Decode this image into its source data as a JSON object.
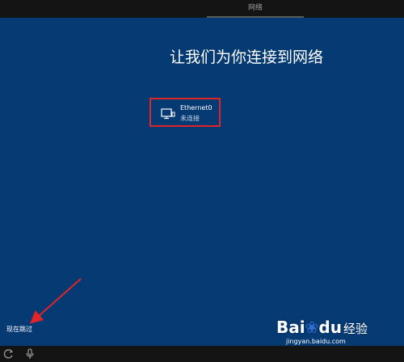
{
  "topbar": {
    "title": "网络"
  },
  "main": {
    "heading": "让我们为你连接到网络"
  },
  "network": {
    "name": "Ethernet0",
    "status": "未连接"
  },
  "skip": {
    "label": "现在跳过"
  },
  "annotation": {
    "arrow_color": "#e0242a"
  },
  "watermark": {
    "logo": "Bai",
    "logo_suffix": "du",
    "logo_cn": "经验",
    "url": "jingyan.baidu.com"
  },
  "icons": {
    "network": "ethernet-icon",
    "ease_of_access": "ease-of-access-icon",
    "microphone": "microphone-icon"
  },
  "colors": {
    "background": "#063a73",
    "bar": "#141414",
    "highlight": "#e0242a"
  }
}
